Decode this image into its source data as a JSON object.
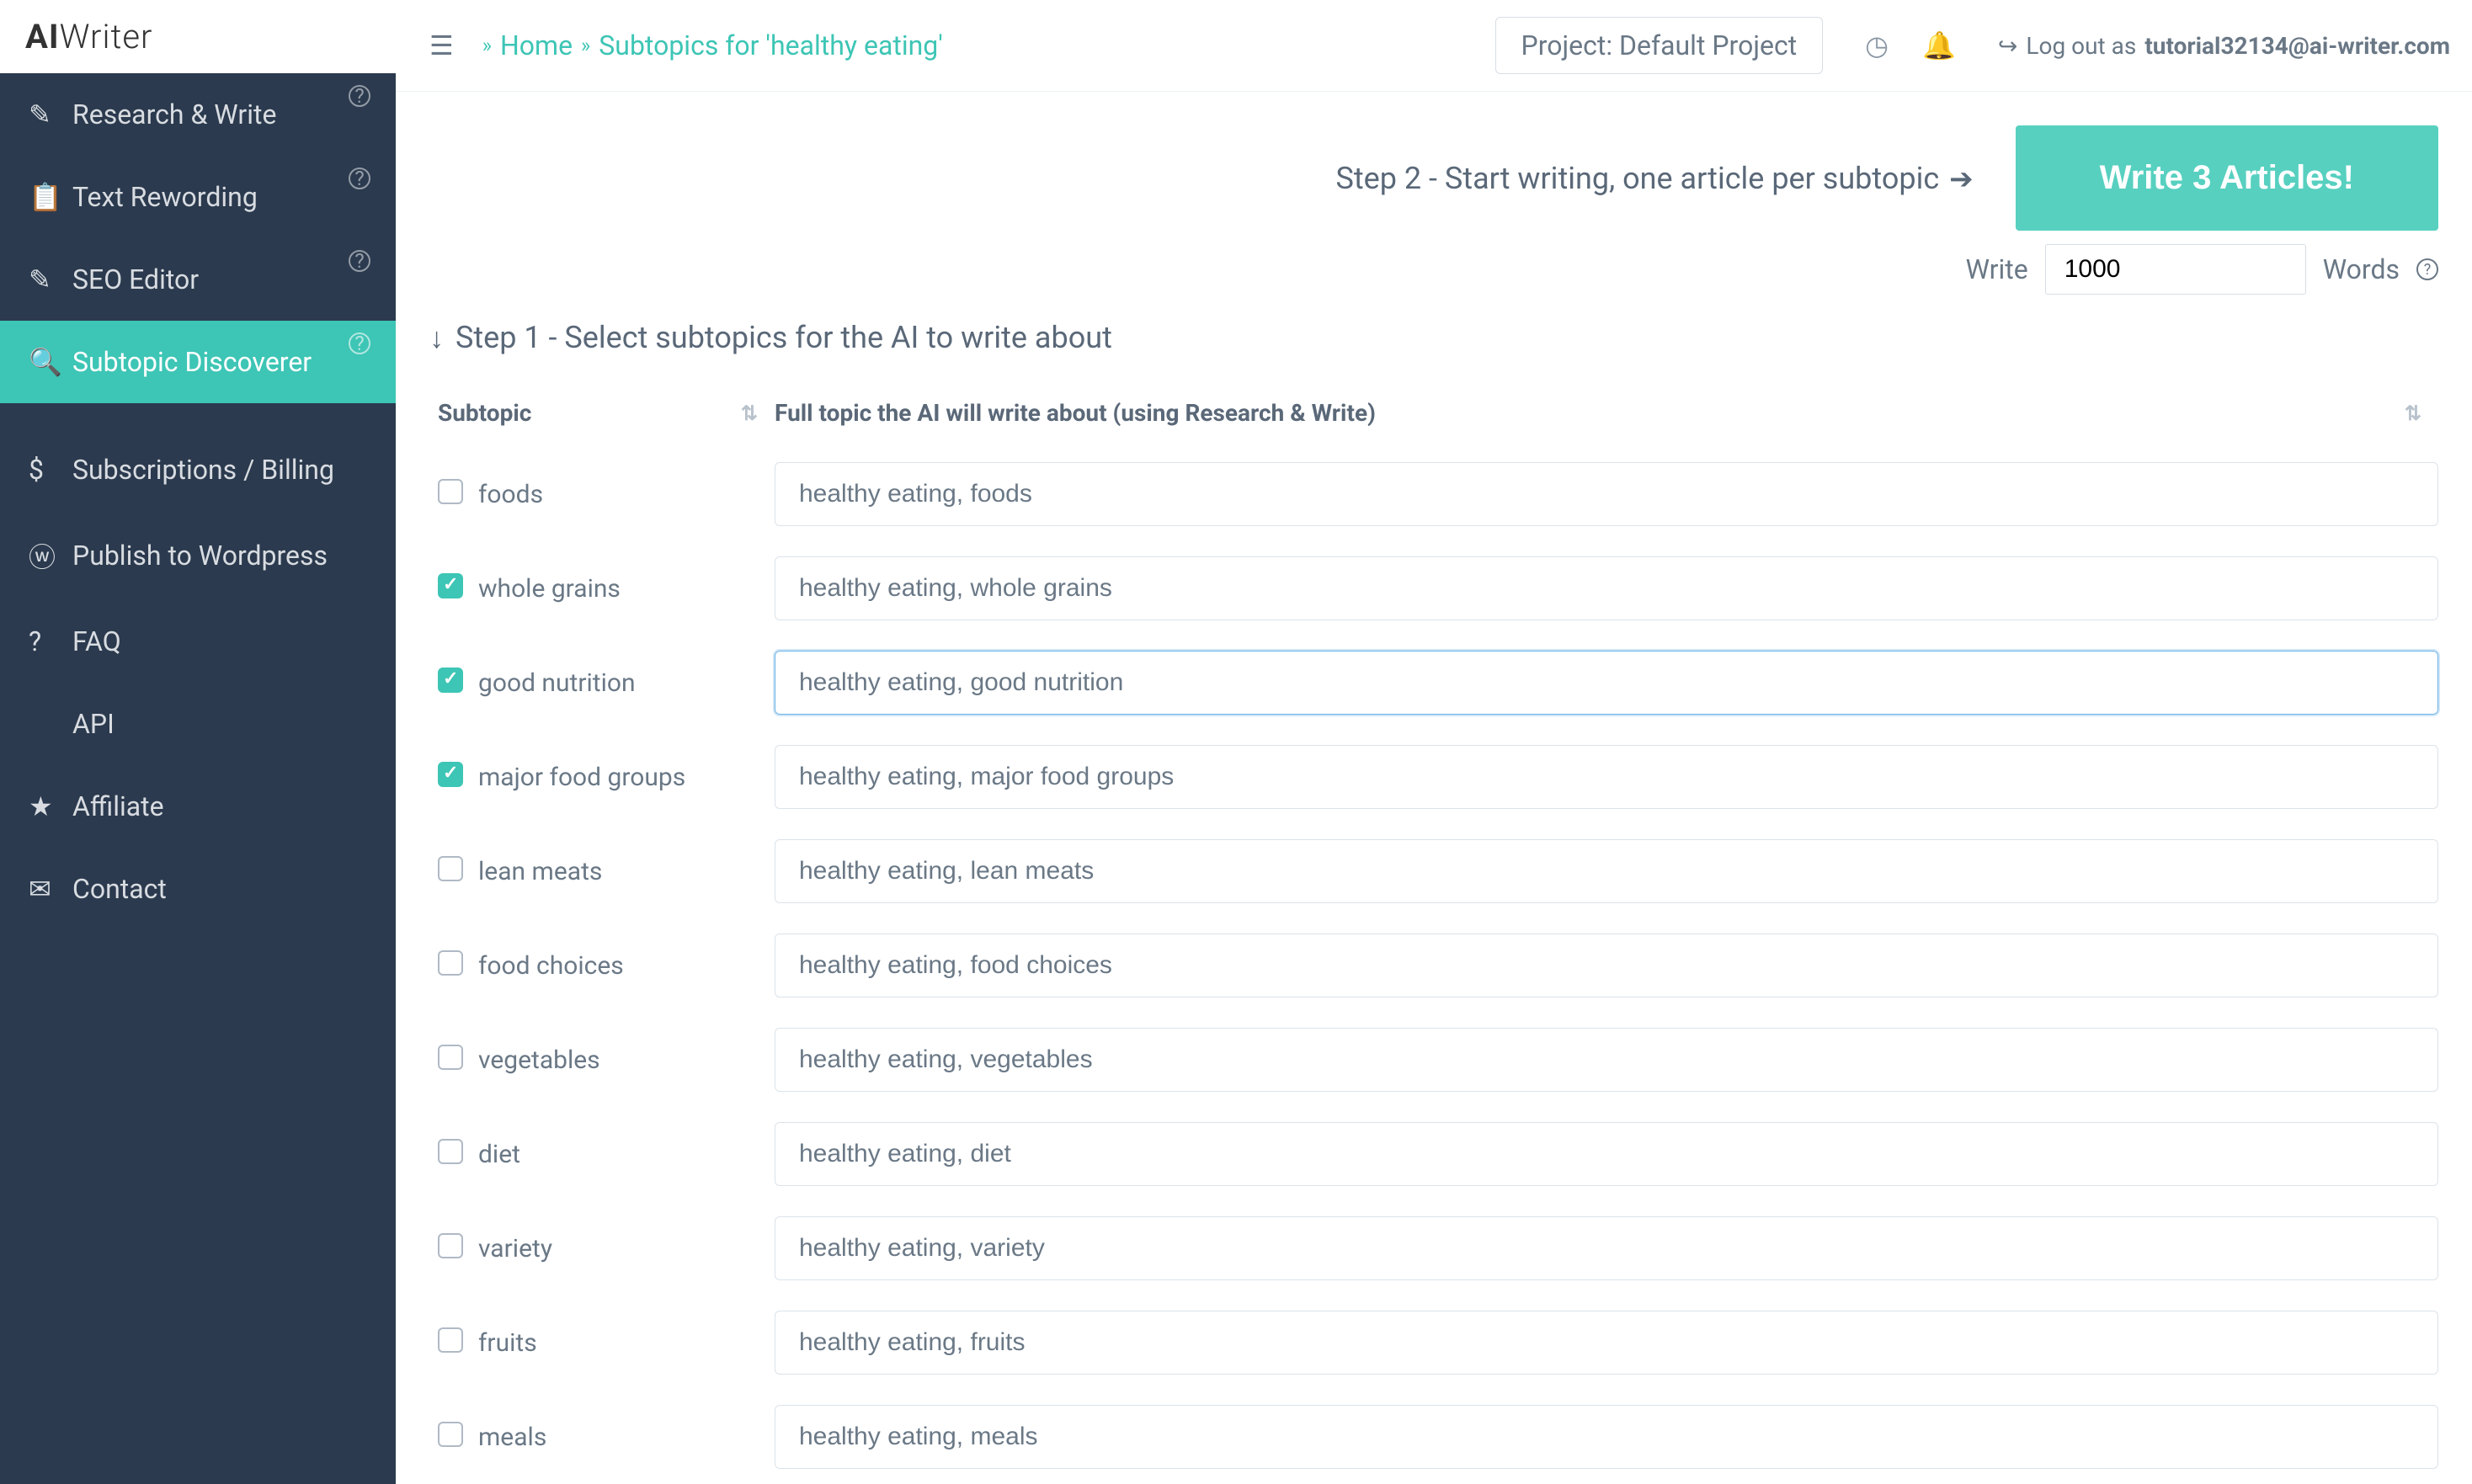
{
  "logo": {
    "bold": "AI",
    "thin": "Writer"
  },
  "sidebar": {
    "items": [
      {
        "label": "Research & Write",
        "icon": "✎",
        "help": true
      },
      {
        "label": "Text Rewording",
        "icon": "📋",
        "help": true
      },
      {
        "label": "SEO Editor",
        "icon": "✎",
        "help": true
      },
      {
        "label": "Subtopic Discoverer",
        "icon": "🔍",
        "help": true,
        "active": true
      },
      {
        "label": "Subscriptions / Billing",
        "icon": "$",
        "help": false
      },
      {
        "label": "Publish to Wordpress",
        "icon": "ⓦ",
        "help": false
      },
      {
        "label": "FAQ",
        "icon": "?",
        "help": false
      },
      {
        "label": "API",
        "icon": "</>",
        "help": false
      },
      {
        "label": "Affiliate",
        "icon": "★",
        "help": false
      },
      {
        "label": "Contact",
        "icon": "✉",
        "help": false
      }
    ]
  },
  "topbar": {
    "breadcrumb_home": "Home",
    "breadcrumb_page": "Subtopics for 'healthy eating'",
    "project": "Project: Default Project",
    "logout_prefix": "Log out as ",
    "logout_user": "tutorial32134@ai-writer.com"
  },
  "steps": {
    "step2": "Step 2 - Start writing, one article per subtopic",
    "write_button": "Write 3 Articles!",
    "write_label": "Write",
    "words_value": "1000",
    "words_label": "Words",
    "step1": "Step 1 - Select subtopics for the AI to write about"
  },
  "table": {
    "header_subtopic": "Subtopic",
    "header_full": "Full topic the AI will write about (using Research & Write)",
    "rows": [
      {
        "checked": false,
        "subtopic": "foods",
        "full": "healthy eating, foods"
      },
      {
        "checked": true,
        "subtopic": "whole grains",
        "full": "healthy eating, whole grains"
      },
      {
        "checked": true,
        "subtopic": "good nutrition",
        "full": "healthy eating, good nutrition",
        "focused": true
      },
      {
        "checked": true,
        "subtopic": "major food groups",
        "full": "healthy eating, major food groups"
      },
      {
        "checked": false,
        "subtopic": "lean meats",
        "full": "healthy eating, lean meats"
      },
      {
        "checked": false,
        "subtopic": "food choices",
        "full": "healthy eating, food choices"
      },
      {
        "checked": false,
        "subtopic": "vegetables",
        "full": "healthy eating, vegetables"
      },
      {
        "checked": false,
        "subtopic": "diet",
        "full": "healthy eating, diet"
      },
      {
        "checked": false,
        "subtopic": "variety",
        "full": "healthy eating, variety"
      },
      {
        "checked": false,
        "subtopic": "fruits",
        "full": "healthy eating, fruits"
      },
      {
        "checked": false,
        "subtopic": "meals",
        "full": "healthy eating, meals"
      }
    ]
  }
}
